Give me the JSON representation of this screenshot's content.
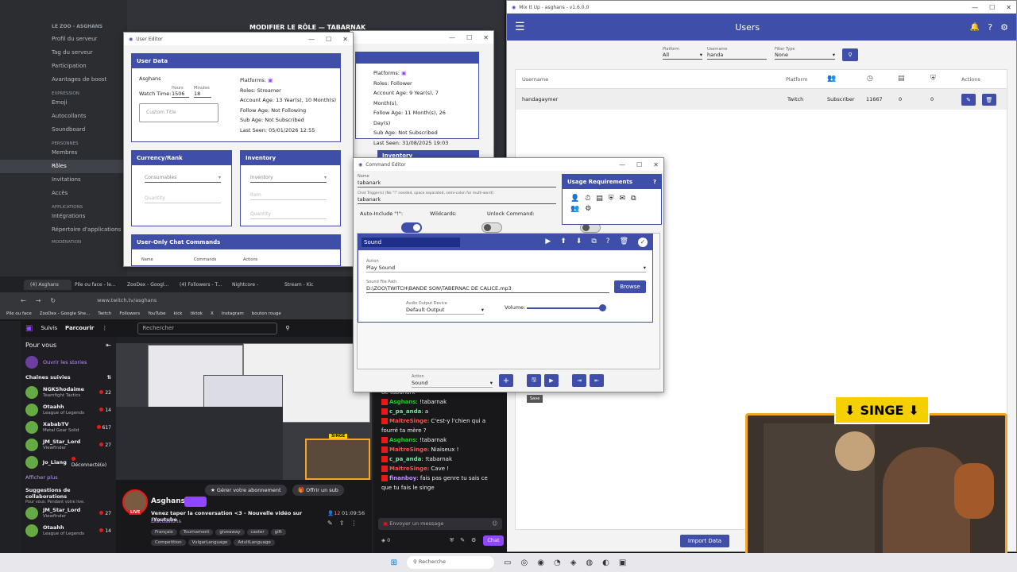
{
  "discord": {
    "server": "LE ZOO - ASGHANS",
    "header": "MODIFIER LE RÔLE — TABARNAK",
    "items": [
      "Profil du serveur",
      "Tag du serveur",
      "Participation",
      "Avantages de boost"
    ],
    "section_expression": "EXPRESSION",
    "expr_items": [
      "Emoji",
      "Autocollants",
      "Soundboard"
    ],
    "section_people": "PERSONNES",
    "people_items": [
      "Membres",
      "Rôles",
      "Invitations",
      "Accès"
    ],
    "section_apps": "APPLICATIONS",
    "app_items": [
      "Intégrations",
      "Répertoire d'applications"
    ],
    "section_mod": "MODÉRATION"
  },
  "user_editor": {
    "title": "User Editor",
    "user_data": "User Data",
    "username": "Asghans",
    "watch_time_label": "Watch Time:",
    "hours_label": "Hours",
    "hours": "1506",
    "minutes_label": "Minutes",
    "minutes": "18",
    "custom_title_placeholder": "Custom Title",
    "platforms": "Platforms:",
    "roles": "Roles:  Streamer",
    "account_age": "Account Age:   13 Year(s), 10 Month(s)",
    "follow_age": "Follow Age:   Not Following",
    "sub_age": "Sub Age:   Not Subscribed",
    "last_seen": "Last Seen:   05/01/2026 12:55",
    "currency_rank": "Currency/Rank",
    "consumables": "Consumables",
    "quantity": "Quantity",
    "inventory": "Inventory",
    "inventory_sel": "Inventory",
    "item": "Item",
    "chat_commands": "User-Only Chat Commands",
    "col_name": "Name",
    "col_commands": "Commands",
    "col_actions": "Actions"
  },
  "user_editor2": {
    "platforms": "Platforms:",
    "roles": "Roles:  Follower",
    "account_age": "Account Age:   9 Year(s), 7 Month(s),",
    "follow_age": "Follow Age:   11 Month(s), 26 Day(s)",
    "sub_age": "Sub Age:   Not Subscribed",
    "last_seen": "Last Seen:   31/08/2025 19:03",
    "inventory": "Inventory"
  },
  "mixitup": {
    "title": "Mix It Up - asghans - v1.6.0.0",
    "header": "Users",
    "platform_label": "Platform",
    "platform_value": "All",
    "username_label": "Username",
    "username_value": "handa",
    "filter_label": "Filter Type",
    "filter_value": "None",
    "col_username": "Username",
    "col_platform": "Platform",
    "col_actions": "Actions",
    "row": {
      "username": "handagaymer",
      "platform": "Twitch",
      "role": "Subscriber",
      "watch": "11667",
      "c1": "0",
      "c2": "0"
    },
    "import": "Import Data"
  },
  "command_editor": {
    "title": "Command Editor",
    "name_label": "Name",
    "name_value": "tabanark",
    "trigger_label": "Chat Trigger(s) (No \"!\" needed, space separated, semi-colon for multi-word)",
    "trigger_value": "tabanark",
    "auto_include": "Auto-Include \"!\":",
    "wildcards": "Wildcards:",
    "unlock": "Unlock Command:",
    "usage": "Usage Requirements",
    "usage_help": "?",
    "action_title": "Sound",
    "action_label": "Action",
    "action_value": "Play Sound",
    "path_label": "Sound File Path",
    "path_value": "D:\\ZOO\\TWITCH\\BANDE SON\\TABERNAC DE CALICE.mp3",
    "browse": "Browse",
    "device_label": "Audio Output Device",
    "device_value": "Default Output",
    "volume": "Volume:",
    "bottom_action_label": "Action",
    "bottom_action_value": "Sound",
    "save_tooltip": "Save"
  },
  "browser": {
    "tabs": [
      "(4) Asghans",
      "Pile ou face - le...",
      "ZooDex - Googl...",
      "(4) Followers - T...",
      "Nightcore -",
      "Stream - Kic"
    ],
    "url": "www.twitch.tv/asghans",
    "bookmarks": [
      "Pile ou face",
      "ZooDex - Google She...",
      "Twitch",
      "Followers",
      "YouTube",
      "kick",
      "tiktok",
      "X",
      "Instagram",
      "bouton rouge"
    ]
  },
  "twitch": {
    "follow": "Suivis",
    "browse": "Parcourir",
    "search_placeholder": "Rechercher",
    "for_you": "Pour vous",
    "open_stories": "Ouvrir les stories",
    "followed": "Chaînes suivies",
    "channels": [
      {
        "name": "NGKShodaime",
        "game": "Teamfight Tactics",
        "viewers": "22"
      },
      {
        "name": "Otaahh",
        "game": "League of Legends",
        "viewers": "14"
      },
      {
        "name": "XababTV",
        "game": "Metal Gear Solid",
        "viewers": "617"
      },
      {
        "name": "JM_Star_Lord",
        "game": "Viewfinder",
        "viewers": "27"
      },
      {
        "name": "Jo_Liang",
        "game": "",
        "viewers": "Déconnecté(e)"
      }
    ],
    "show_more": "Afficher plus",
    "collab": "Suggestions de collaborations",
    "collab_sub": "Pour vous. Pendant votre live.",
    "collab_channels": [
      {
        "name": "JM_Star_Lord",
        "game": "Viewfinder",
        "viewers": "27"
      },
      {
        "name": "Otaahh",
        "game": "League of Legends",
        "viewers": "14"
      }
    ],
    "streamer": "Asghans",
    "manage_sub": "Gérer votre abonnement",
    "gift_sub": "Offrir un sub",
    "stream_title": "Venez taper la conversation <3 - Nouvelle vidéo sur !Youtube",
    "viewers": "12",
    "uptime": "01:09:56",
    "category": "Discussions",
    "tags": [
      "Français",
      "Tournament",
      "giveaway",
      "caster",
      "gift",
      "Competition",
      "VulgarLanguage",
      "AdultLanguage"
    ],
    "live": "LIVE",
    "singe_small": "SINGE"
  },
  "chat": {
    "messages": [
      {
        "user": "",
        "text": "de tabanark"
      },
      {
        "user": "Asghans",
        "text": "!tabarnak"
      },
      {
        "user": "c_pa_anda",
        "text": "a"
      },
      {
        "user": "MaitreSinge",
        "text": "C'est-y l'chien qui a fourré ta mère ?"
      },
      {
        "user": "Asghans",
        "text": "!tabarnak"
      },
      {
        "user": "MaitreSinge",
        "text": "Niaiseux !"
      },
      {
        "user": "c_pa_anda",
        "text": "!tabarnak"
      },
      {
        "user": "MaitreSinge",
        "text": "Cave !"
      },
      {
        "user": "finanboy",
        "text": "fais pas genre tu sais ce que tu fais le singe"
      }
    ],
    "placeholder": "Envoyer un message",
    "points": "0",
    "chat_btn": "Chat"
  },
  "overlay": {
    "singe": "SINGE"
  },
  "taskbar": {
    "search": "Recherche"
  }
}
